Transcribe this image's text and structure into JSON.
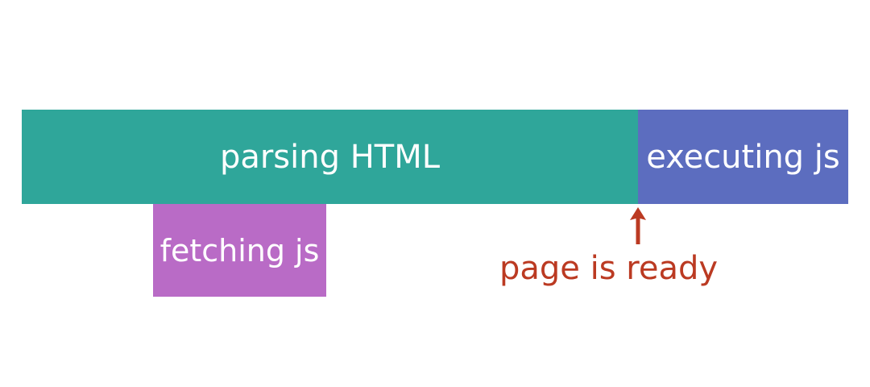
{
  "timeline": {
    "parsing": {
      "label": "parsing HTML",
      "color": "#2fa69a"
    },
    "executing": {
      "label": "executing js",
      "color": "#5c6dbf"
    },
    "fetching": {
      "label": "fetching js",
      "color": "#b96bc6"
    },
    "marker": {
      "label": "page is ready",
      "color": "#bb3a22",
      "icon": "arrow-up-icon"
    }
  }
}
